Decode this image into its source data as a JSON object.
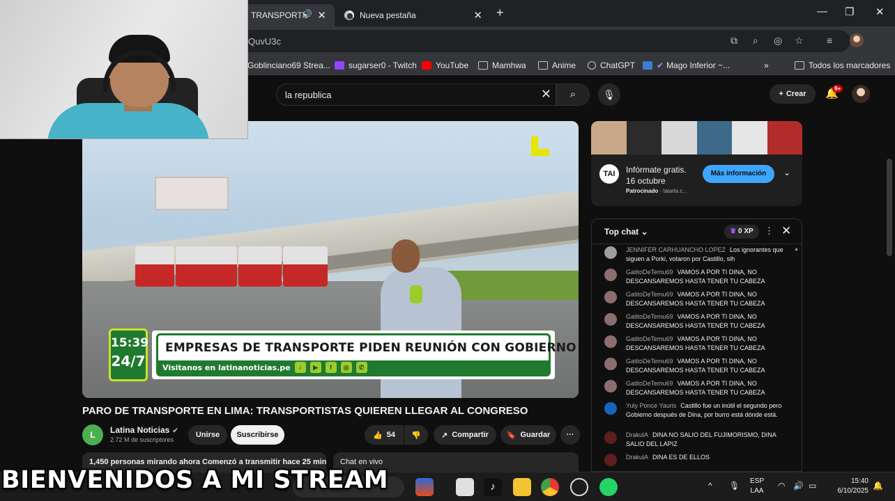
{
  "browser": {
    "tabs": [
      {
        "title": "TRANSPORTE",
        "active": true
      },
      {
        "title": "Nueva pestaña",
        "active": false
      }
    ],
    "url_fragment": "QuvU3c",
    "bookmarks": [
      {
        "label": "Goblinciano69 Strea...",
        "icon": "twitch-icon"
      },
      {
        "label": "sugarser0 - Twitch",
        "icon": "twitch-icon"
      },
      {
        "label": "YouTube",
        "icon": "youtube-icon"
      },
      {
        "label": "Mamhwa",
        "icon": "folder-icon"
      },
      {
        "label": "Anime",
        "icon": "folder-icon"
      },
      {
        "label": "ChatGPT",
        "icon": "chatgpt-icon"
      },
      {
        "label": "Mago Inferior ~...",
        "icon": "bookmark-icon"
      }
    ],
    "all_bookmarks_label": "Todos los marcadores",
    "overflow_label": "»"
  },
  "youtube": {
    "search_query": "la republica",
    "create_label": "Crear",
    "notification_count": "9+",
    "video": {
      "overlay": {
        "time": "15:39",
        "channel_tag": "24/7",
        "headline": "EMPRESAS DE TRANSPORTE PIDEN REUNIÓN CON GOBIERNO",
        "visit_text": "Visitanos en latinanoticias.pe"
      },
      "title": "PARO DE TRANSPORTE EN LIMA: TRANSPORTISTAS QUIEREN LLEGAR AL CONGRESO",
      "channel_name": "Latina Noticias",
      "channel_initial": "L",
      "subscribers": "2.72 M de suscriptores",
      "join_label": "Unirse",
      "subscribe_label": "Suscribirse",
      "likes": "54",
      "share_label": "Compartir",
      "save_label": "Guardar",
      "more_label": "···"
    },
    "description_preview": "1,450 personas mirando ahora  Comenzó a transmitir hace 25 minutos",
    "chat_replay_label": "Chat en vivo",
    "ad": {
      "logo_text": "TAI",
      "title": "Infórmate gratis. 16 octubre",
      "sponsor_label": "Patrocinado",
      "sponsor_domain": "taiarla.c...",
      "cta_label": "Más información"
    },
    "live_chat": {
      "mode_label": "Top chat",
      "xp_label": "0 XP",
      "messages": [
        {
          "author": "JENNIFER CARHUANCHO LOPEZ",
          "text": "Los ignorantes que siguen a Porki, votaron por Castillo, sih",
          "avatar_color": "#9e9e9e"
        },
        {
          "author": "GatitoDeTemu69",
          "text": "VAMOS A POR TI DINA, NO DESCANSAREMOS HASTA TENER TU CABEZA",
          "avatar_color": "#8d6e6e"
        },
        {
          "author": "GatitoDeTemu69",
          "text": "VAMOS A POR TI DINA, NO DESCANSAREMOS HASTA TENER TU CABEZA",
          "avatar_color": "#8d6e6e"
        },
        {
          "author": "GatitoDeTemu69",
          "text": "VAMOS A POR TI DINA, NO DESCANSAREMOS HASTA TENER TU CABEZA",
          "avatar_color": "#8d6e6e"
        },
        {
          "author": "GatitoDeTemu69",
          "text": "VAMOS A POR TI DINA, NO DESCANSAREMOS HASTA TENER TU CABEZA",
          "avatar_color": "#8d6e6e"
        },
        {
          "author": "GatitoDeTemu69",
          "text": "VAMOS A POR TI DINA, NO DESCANSAREMOS HASTA TENER TU CABEZA",
          "avatar_color": "#8d6e6e"
        },
        {
          "author": "GatitoDeTemu69",
          "text": "VAMOS A POR TI DINA, NO DESCANSAREMOS HASTA TENER TU CABEZA",
          "avatar_color": "#8d6e6e"
        },
        {
          "author": "Yuly Ponce Yauris",
          "text": "Castillo fue un inútil el segundo pero Gobierno después de Dina, por burro está dónde está.",
          "avatar_color": "#1565c0"
        },
        {
          "author": "DrakulA",
          "text": "DINA NO SALIO DEL FUJIMORISMO, DINA SALIO DEL LAPIZ",
          "avatar_color": "#5d1f1f"
        },
        {
          "author": "DrakulA",
          "text": "DINA ES DE ELLOS",
          "avatar_color": "#5d1f1f"
        }
      ]
    }
  },
  "taskbar": {
    "language": "ESP",
    "language_sub": "LAA",
    "time": "15:40",
    "date": "6/10/2025"
  },
  "stream_banner": "BIENVENIDOS A MI STREAM"
}
